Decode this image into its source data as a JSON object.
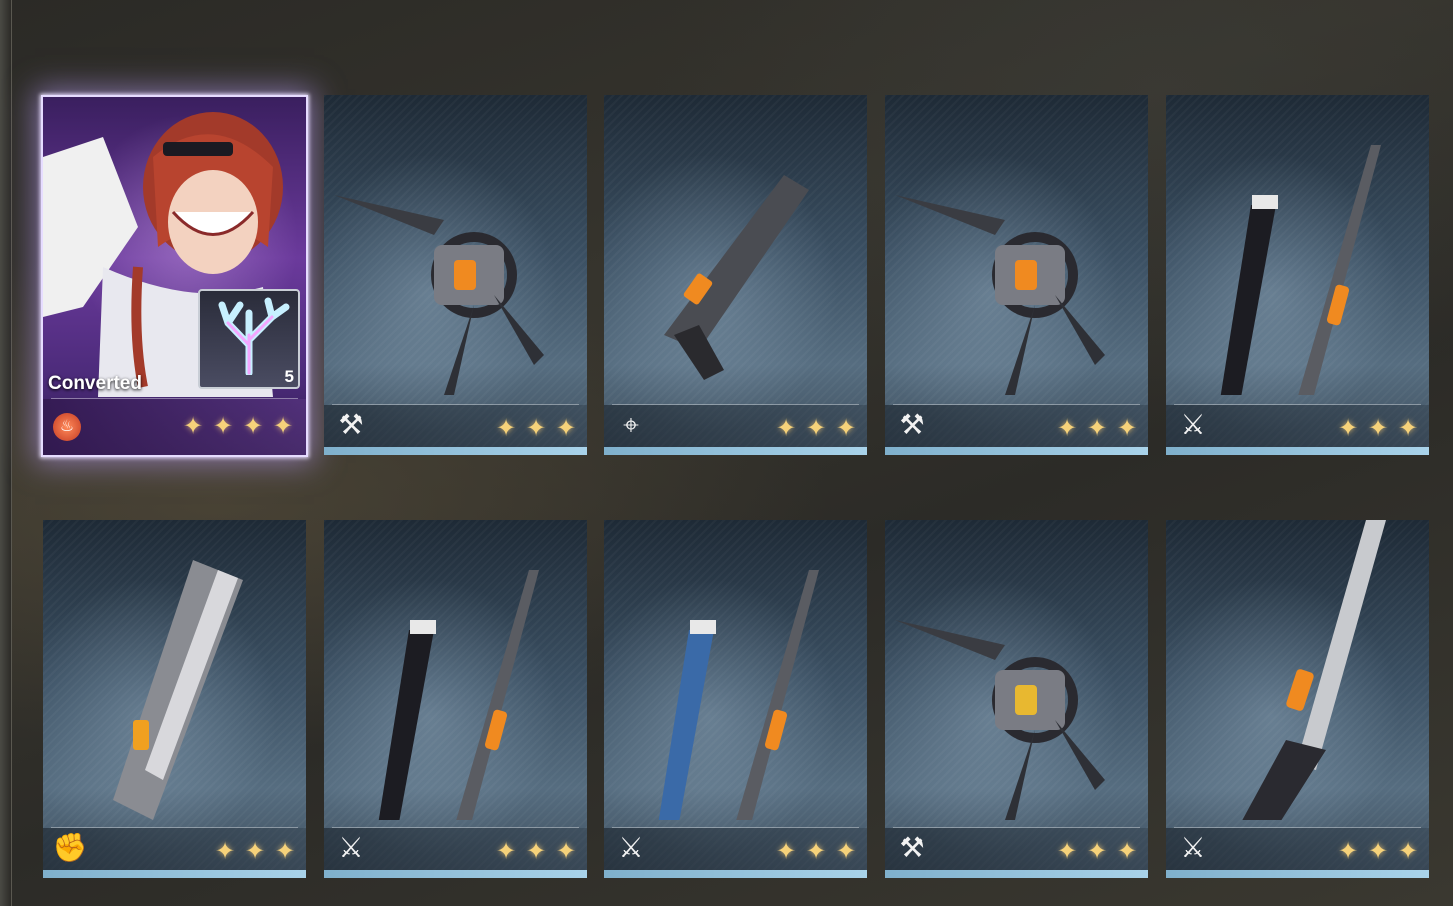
{
  "colors": {
    "star": "#f6d27a",
    "bar": "#a9d3ea",
    "highlight": "#e6dcff"
  },
  "featured": {
    "label": "Converted",
    "item_count": "5",
    "element_icon": "fire-element-icon",
    "rarity": 4
  },
  "cards": [
    {
      "type_icon": "heavy-gauntlet-icon",
      "weapon": "gauntlet",
      "rarity": 3
    },
    {
      "type_icon": "pistol-icon",
      "weapon": "pistol",
      "rarity": 3
    },
    {
      "type_icon": "heavy-gauntlet-icon",
      "weapon": "gauntlet",
      "rarity": 3
    },
    {
      "type_icon": "sword-icon",
      "weapon": "blade",
      "rarity": 3
    },
    {
      "type_icon": "fist-icon",
      "weapon": "bracer",
      "rarity": 3
    },
    {
      "type_icon": "sword-icon",
      "weapon": "blade",
      "rarity": 3
    },
    {
      "type_icon": "sword-icon",
      "weapon": "blade-blue",
      "rarity": 3
    },
    {
      "type_icon": "heavy-gauntlet-icon",
      "weapon": "gauntlet-gold",
      "rarity": 3
    },
    {
      "type_icon": "broadblade-icon",
      "weapon": "broadblade",
      "rarity": 3
    }
  ]
}
